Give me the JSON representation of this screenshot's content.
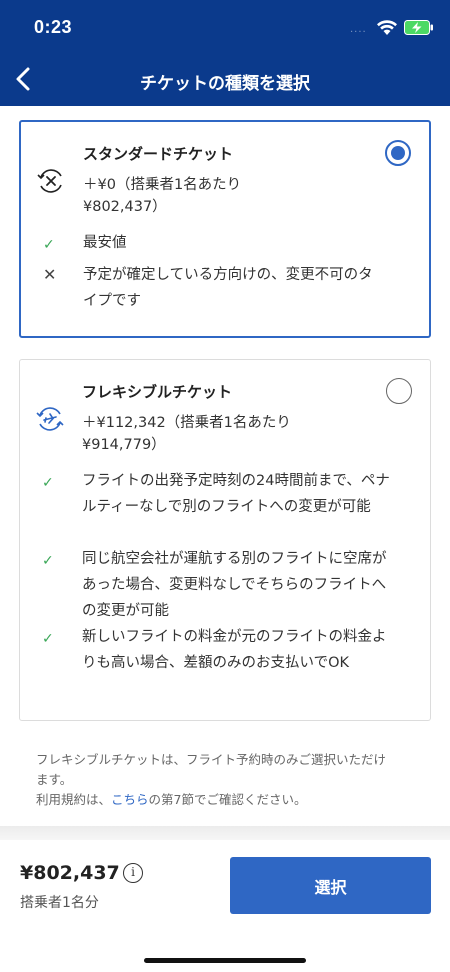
{
  "status_bar": {
    "time": "0:23",
    "signal": "...."
  },
  "nav": {
    "title": "チケットの種類を選択",
    "back_icon": "chevron-left-icon"
  },
  "options": [
    {
      "name": "スタンダードチケット",
      "price_line1": "＋¥0（搭乗者1名あたり",
      "price_line2": "¥802,437）",
      "icon": "plane-cross-icon",
      "selected": true,
      "features": [
        {
          "mark": "check",
          "text": "最安値"
        },
        {
          "mark": "cross",
          "text": "予定が確定している方向けの、変更不可のタイプです"
        }
      ]
    },
    {
      "name": "フレキシブルチケット",
      "price_line1": "＋¥112,342（搭乗者1名あたり",
      "price_line2": "¥914,779）",
      "icon": "plane-arrows-icon",
      "selected": false,
      "features": [
        {
          "mark": "check",
          "text": "フライトの出発予定時刻の24時間前まで、ペナルティーなしで別のフライトへの変更が可能"
        },
        {
          "mark": "check",
          "text": "同じ航空会社が運航する別のフライトに空席があった場合、変更料なしでそちらのフライトへの変更が可能"
        },
        {
          "mark": "check",
          "text": "新しいフライトの料金が元のフライトの料金よりも高い場合、差額のみのお支払いでOK"
        }
      ]
    }
  ],
  "footnote": {
    "line1": "フレキシブルチケットは、フライト予約時のみご選択いただけます。",
    "line2_prefix": "利用規約は、",
    "link": "こちら",
    "line2_suffix": "の第7節でご確認ください。"
  },
  "bottom": {
    "total": "¥802,437",
    "per_passenger": "搭乗者1名分",
    "select_label": "選択",
    "info_symbol": "i"
  },
  "colors": {
    "header": "#0b3a8c",
    "accent": "#2f67c4",
    "check": "#3aa757"
  }
}
